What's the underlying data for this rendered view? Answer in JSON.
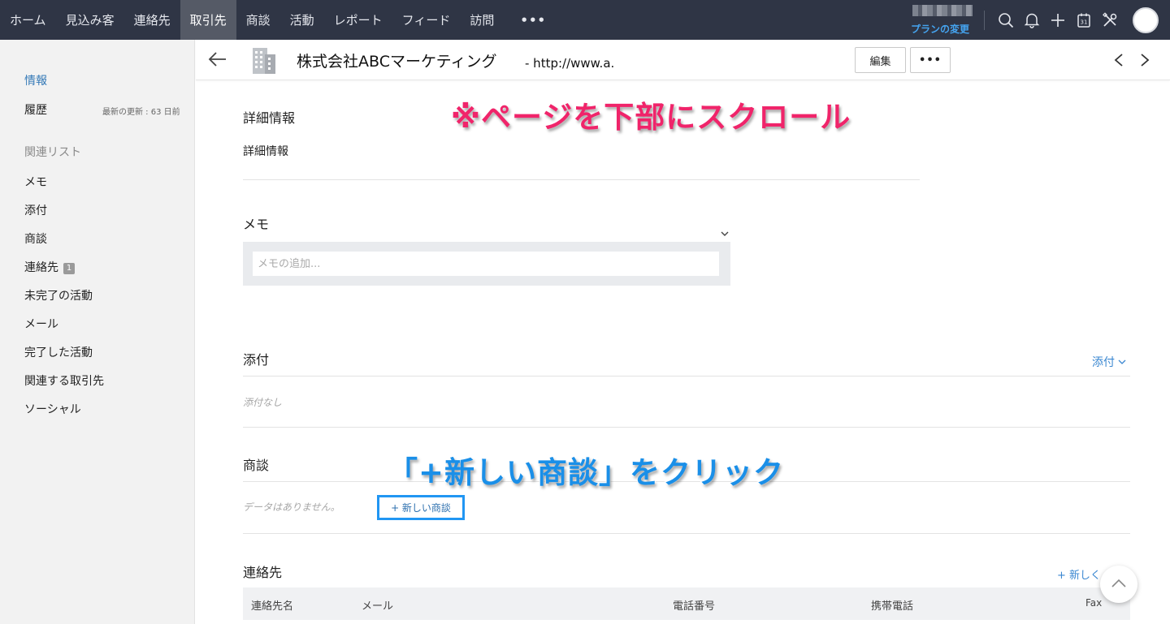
{
  "nav": {
    "items": [
      "ホーム",
      "見込み客",
      "連絡先",
      "取引先",
      "商談",
      "活動",
      "レポート",
      "フィード",
      "訪問"
    ],
    "active_index": 3,
    "more_label": "•••",
    "plan_label": "プランの変更"
  },
  "icons": {
    "search": "search-icon",
    "bell": "bell-icon",
    "plus": "plus-icon",
    "calendar": "calendar-icon",
    "tools": "tools-icon",
    "calendar_day": "31"
  },
  "sidebar": {
    "info": "情報",
    "history": "履歴",
    "last_updated": "最新の更新 : 63 日前",
    "related_list": "関連リスト",
    "items": [
      {
        "label": "メモ"
      },
      {
        "label": "添付"
      },
      {
        "label": "商談"
      },
      {
        "label": "連絡先",
        "count": "1"
      },
      {
        "label": "未完了の活動"
      },
      {
        "label": "メール"
      },
      {
        "label": "完了した活動"
      },
      {
        "label": "関連する取引先"
      },
      {
        "label": "ソーシャル"
      }
    ]
  },
  "header": {
    "title": "株式会社ABCマーケティング",
    "url": "- http://www.a.",
    "edit_label": "編集",
    "more_label": "•••"
  },
  "details": {
    "heading": "詳細情報",
    "subheading": "詳細情報"
  },
  "notes": {
    "heading": "メモ",
    "placeholder": "メモの追加..."
  },
  "attachments": {
    "heading": "添付",
    "action_label": "添付",
    "empty_text": "添付なし"
  },
  "deals": {
    "heading": "商談",
    "empty_text": "データはありません。",
    "new_label": "+ 新しい商談"
  },
  "contacts": {
    "heading": "連絡先",
    "new_label": "+ 新しく",
    "columns": [
      "連絡先名",
      "メール",
      "電話番号",
      "携帯電話",
      "Fax"
    ]
  },
  "annotations": {
    "scroll": "※ページを下部にスクロール",
    "click": "「+新しい商談」をクリック"
  },
  "colors": {
    "nav_bg": "#2f3545",
    "nav_active": "#555a66",
    "link": "#3a87d1",
    "annot_pink": "#f0246a",
    "annot_blue": "#1a8fe8"
  }
}
